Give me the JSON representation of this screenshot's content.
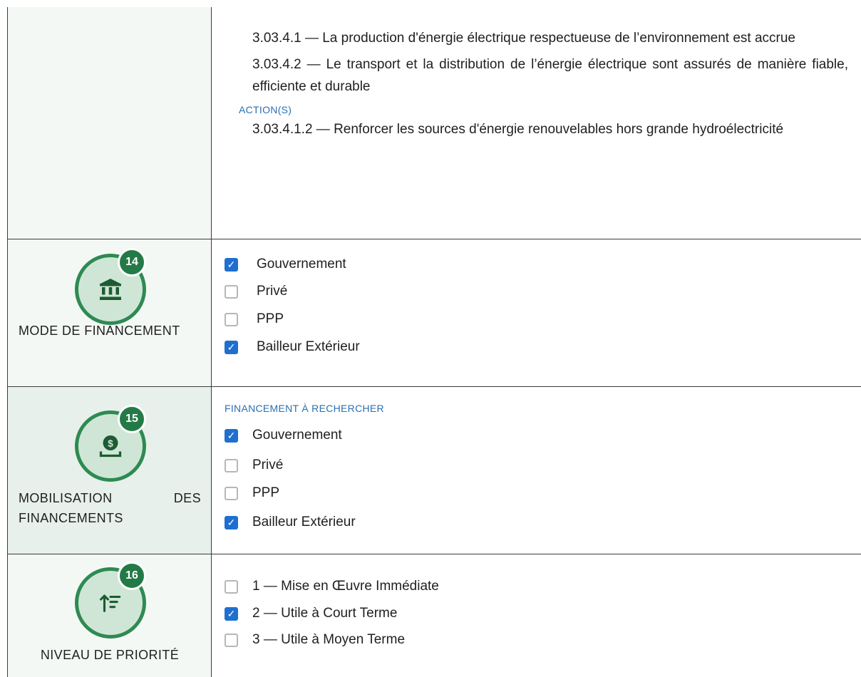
{
  "objectives_block": {
    "paragraphs": [
      "3.03.4.1 — La production d'énergie électrique respectueuse de l’environnement est accrue",
      "3.03.4.2 — Le transport et la distribution de l’énergie électrique sont assurés de manière fiable, efficiente et durable"
    ],
    "actions_label": "ACTION(S)",
    "actions": [
      "3.03.4.1.2 — Renforcer les sources d'énergie renouvelables hors grande hydroélectricité"
    ]
  },
  "mode_financement": {
    "number": "14",
    "icon": "bank-icon",
    "label": "MODE DE FINANCEMENT",
    "options": [
      {
        "label": "Gouvernement",
        "checked": true
      },
      {
        "label": "Privé",
        "checked": false
      },
      {
        "label": "PPP",
        "checked": false
      },
      {
        "label": "Bailleur Extérieur",
        "checked": true
      }
    ]
  },
  "mobilisation": {
    "number": "15",
    "icon": "money-deposit-icon",
    "label": "MOBILISATION DES FINANCEMENTS",
    "sublabel": "FINANCEMENT À RECHERCHER",
    "options": [
      {
        "label": "Gouvernement",
        "checked": true
      },
      {
        "label": "Privé",
        "checked": false
      },
      {
        "label": "PPP",
        "checked": false
      },
      {
        "label": "Bailleur Extérieur",
        "checked": true
      }
    ]
  },
  "priorite": {
    "number": "16",
    "icon": "sort-priority-icon",
    "label": "NIVEAU DE PRIORITÉ",
    "options": [
      {
        "label": "1 — Mise en Œuvre Immédiate",
        "checked": false
      },
      {
        "label": "2 — Utile à Court Terme",
        "checked": true
      },
      {
        "label": "3 — Utile à Moyen Terme",
        "checked": false
      }
    ]
  },
  "colors": {
    "accent_green": "#2e8a52",
    "badge_fill": "#cfe6d6",
    "checkbox_blue": "#1f6fcf",
    "label_blue": "#2a6fb3"
  }
}
